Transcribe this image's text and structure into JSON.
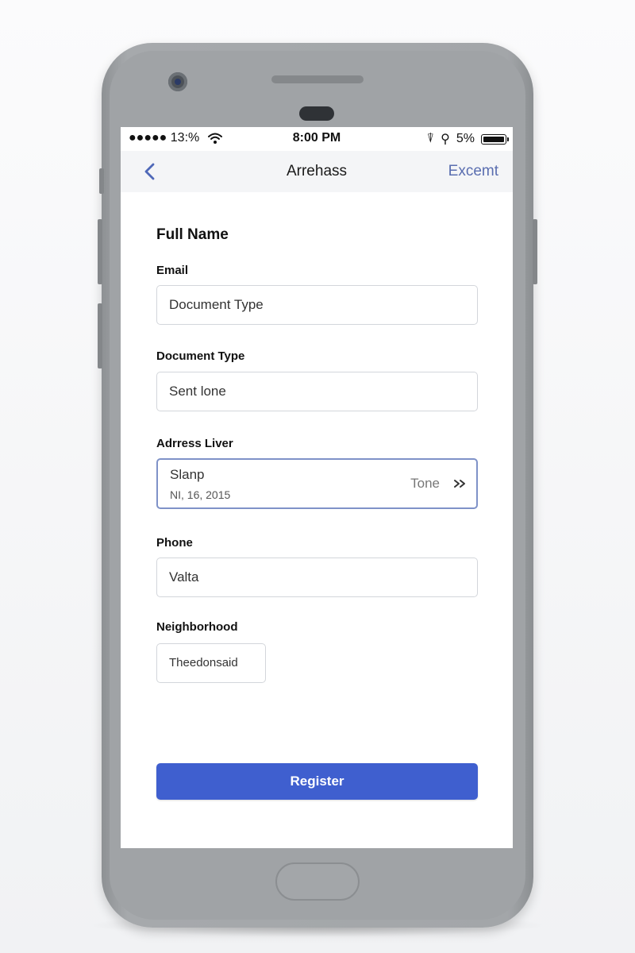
{
  "status_bar": {
    "signal": "●●●●● 13:%",
    "time": "8:00 PM",
    "location_glyph": "⍒",
    "alarm_glyph": "⚲",
    "battery_percent": "5%",
    "icons": [
      "signal-dots-icon",
      "wifi-icon",
      "location-icon",
      "alarm-icon",
      "battery-icon"
    ]
  },
  "nav": {
    "title": "Arrehass",
    "action_label": "Excemt",
    "back_icon": "chevron-left-icon",
    "accent_color": "#5a6eb0"
  },
  "form": {
    "section_title": "Full Name",
    "fields": [
      {
        "label": "Email",
        "value": "Document Type"
      },
      {
        "label": "Document Type",
        "value": "Sent lone"
      },
      {
        "label": "Adrress Liver",
        "value": "Slanp",
        "sub_value": "NI, 16, 2015",
        "selected": "Tone",
        "icon": "double-chevron-right-icon",
        "focused": true
      },
      {
        "label": "Phone",
        "value": "Valta"
      },
      {
        "label": "Neighborhood",
        "value": "Theedonsaid"
      }
    ],
    "submit_label": "Register",
    "submit_color": "#3f5fcf"
  }
}
